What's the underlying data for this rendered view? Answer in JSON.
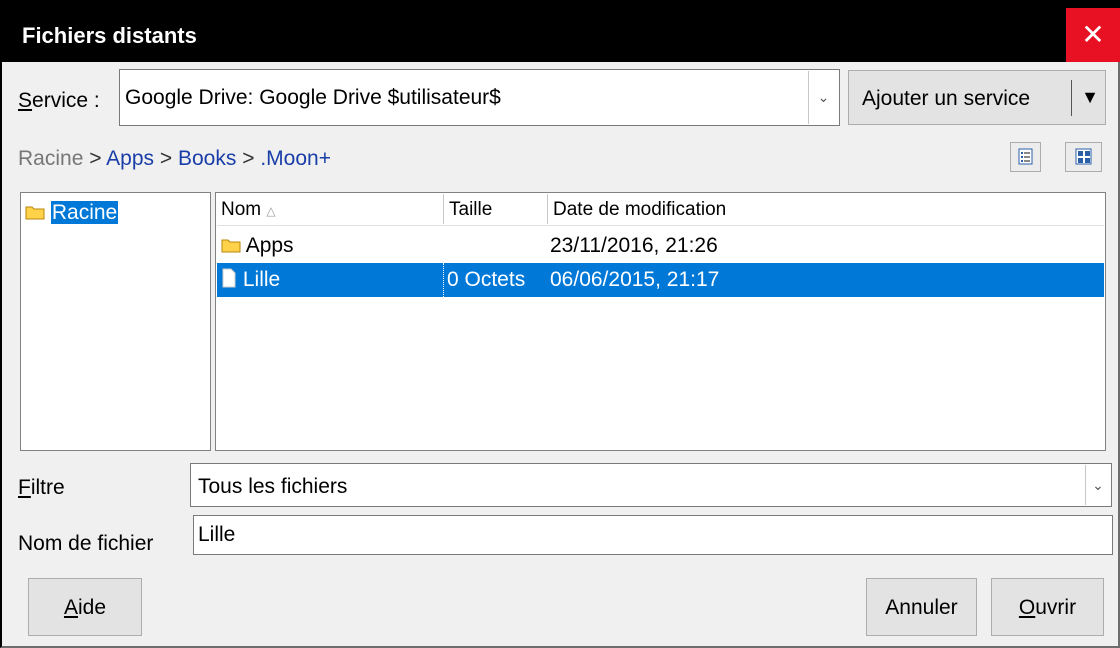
{
  "window": {
    "title": "Fichiers distants",
    "close_glyph": "✕"
  },
  "service": {
    "label_mnemonic": "S",
    "label_rest": "ervice :",
    "value": "Google Drive: Google Drive $utilisateur$",
    "add_button_label": "Ajouter un service"
  },
  "breadcrumb": {
    "root": "Racine",
    "sep": ">",
    "items": [
      "Apps",
      "Books",
      ".Moon+"
    ]
  },
  "tree": {
    "items": [
      {
        "label": "Racine",
        "selected": true
      }
    ]
  },
  "files": {
    "columns": {
      "name": "Nom",
      "size": "Taille",
      "date": "Date de modification"
    },
    "rows": [
      {
        "type": "folder",
        "name": "Apps",
        "size": "",
        "date": "23/11/2016, 21:26",
        "selected": false
      },
      {
        "type": "file",
        "name": "Lille",
        "size": "0 Octets",
        "date": "06/06/2015, 21:17",
        "selected": true
      }
    ]
  },
  "filter": {
    "label_mnemonic": "F",
    "label_rest": "iltre",
    "value": "Tous les fichiers"
  },
  "filename": {
    "label": "Nom de fichier",
    "value": "Lille"
  },
  "buttons": {
    "help_mnemonic": "A",
    "help_rest": "ide",
    "cancel": "Annuler",
    "open_mnemonic": "O",
    "open_rest": "uvrir"
  },
  "colors": {
    "selection": "#0078d7",
    "close": "#e81123",
    "link": "#1a3ea8",
    "folder": "#ffd24a"
  }
}
